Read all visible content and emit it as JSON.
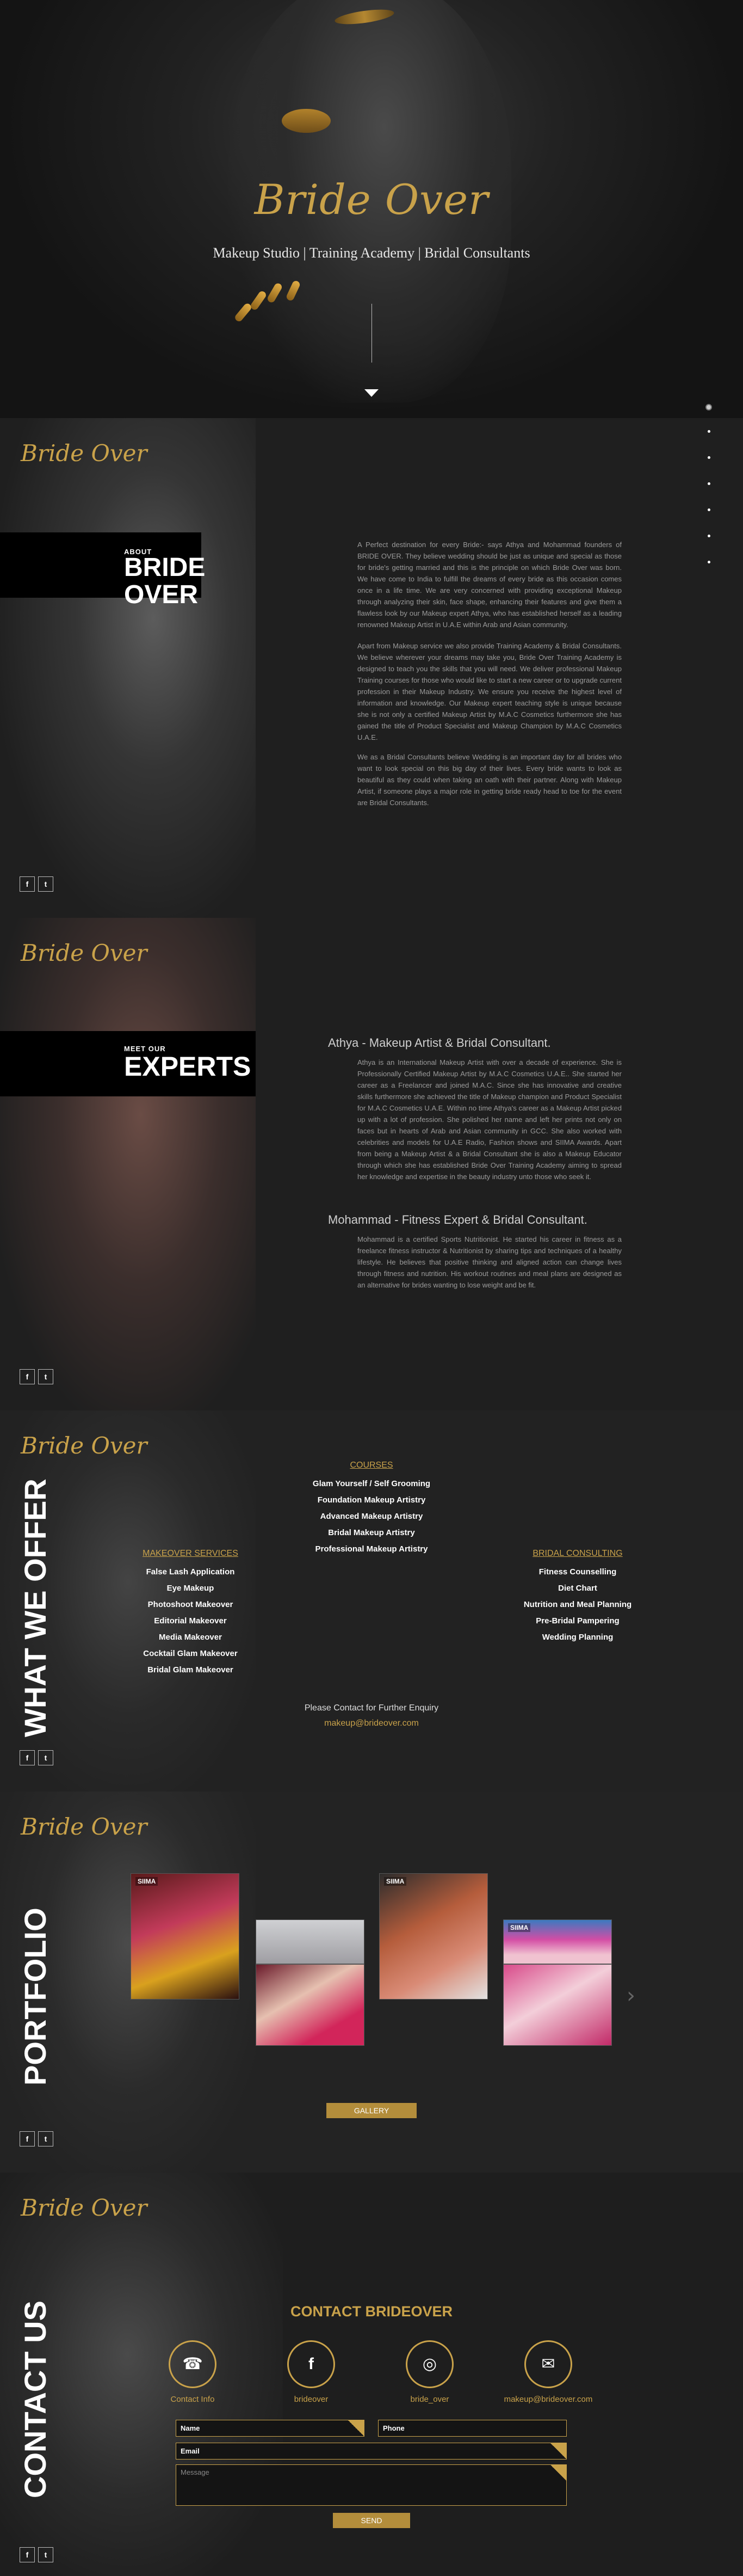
{
  "hero": {
    "logo": "Bride Over",
    "tagline": "Makeup Studio | Training Academy | Bridal Consultants"
  },
  "brand_logo": "Bride Over",
  "social": {
    "facebook": "f",
    "twitter": "t"
  },
  "about": {
    "small_title": "ABOUT",
    "big_title_1": "BRIDE",
    "big_title_2": "OVER",
    "paragraphs": [
      "A Perfect destination for every Bride:- says Athya and Mohammad founders of BRIDE OVER. They believe wedding should be just as unique and special as those for bride's getting married and this is the principle on which Bride Over was born. We have come to India to fulfill the dreams of every bride as this occasion comes once in a life time. We are very concerned with providing exceptional Makeup through analyzing their skin, face shape, enhancing their features and give them a flawless look by our Makeup expert Athya, who has established herself as a leading renowned Makeup Artist in U.A.E within Arab and Asian community.",
      "Apart from Makeup service we also provide Training Academy & Bridal Consultants. We believe wherever your dreams may take you, Bride Over Training Academy is designed to teach you the skills that you will need. We deliver professional Makeup Training courses for those who would like to start a new career or to upgrade current profession in their Makeup Industry. We ensure you receive the highest level of information and knowledge. Our Makeup expert teaching style is unique because she is not only a certified Makeup Artist by M.A.C Cosmetics furthermore she has gained the title of Product Specialist and Makeup Champion by M.A.C Cosmetics U.A.E.",
      "We as a Bridal Consultants believe Wedding is an important day for all brides who want to look special on this big day of their lives. Every bride wants to look as beautiful as they could when taking an oath with their partner. Along with Makeup Artist, if someone plays a major role in getting bride ready head to toe for the event are Bridal Consultants."
    ]
  },
  "experts": {
    "small_title": "MEET OUR",
    "big_title": "EXPERTS",
    "people": [
      {
        "heading": "Athya - Makeup Artist & Bridal Consultant.",
        "text": "Athya is an International Makeup Artist with over a decade of experience. She is Professionally Certified Makeup Artist by M.A.C Cosmetics U.A.E.. She started her career as a Freelancer and joined M.A.C. Since she has innovative and creative skills furthermore she achieved the title of Makeup champion and Product Specialist for M.A.C Cosmetics U.A.E. Within no time Athya's career as a Makeup Artist picked up with a lot of profession. She polished her name and left her prints not only on faces but in hearts of Arab and Asian community in GCC. She also worked with celebrities and models for U.A.E Radio, Fashion shows and SIIMA Awards. Apart from being a Makeup Artist & a Bridal Consultant she is also a Makeup Educator through which she has established Bride Over Training Academy aiming to spread her knowledge and expertise in the beauty industry unto those who seek it."
      },
      {
        "heading": "Mohammad - Fitness Expert & Bridal Consultant.",
        "text": "Mohammad is a certified Sports Nutritionist. He started his career in fitness as a freelance fitness instructor & Nutritionist by sharing tips and techniques of a healthy lifestyle. He believes that positive thinking and aligned action can change lives through fitness and nutrition. His workout routines and meal plans are designed as an alternative for brides wanting to lose weight and be fit."
      }
    ]
  },
  "services": {
    "vertical_title": "WHAT WE OFFER",
    "courses": {
      "head": "COURSES",
      "items": [
        "Glam Yourself / Self Grooming",
        "Foundation Makeup Artistry",
        "Advanced Makeup Artistry",
        "Bridal Makeup Artistry",
        "Professional Makeup Artistry"
      ]
    },
    "makeover": {
      "head": "MAKEOVER SERVICES",
      "items": [
        "False Lash Application",
        "Eye Makeup",
        "Photoshoot Makeover",
        "Editorial Makeover",
        "Media Makeover",
        "Cocktail Glam Makeover",
        "Bridal Glam Makeover"
      ]
    },
    "bridal": {
      "head": "BRIDAL CONSULTING",
      "items": [
        "Fitness Counselling",
        "Diet Chart",
        "Nutrition and Meal Planning",
        "Pre-Bridal Pampering",
        "Wedding Planning"
      ]
    },
    "contact_line": "Please Contact for Further Enquiry",
    "email": "makeup@brideover.com"
  },
  "portfolio": {
    "vertical_title": "PORTFOLIO",
    "photo_label": "SIIMA",
    "next": "›",
    "gallery_button": "GALLERY"
  },
  "contact": {
    "vertical_title": "CONTACT US",
    "heading": "CONTACT BRIDEOVER",
    "icons": [
      {
        "glyph": "☎",
        "label": "Contact Info"
      },
      {
        "glyph": "f",
        "label": "brideover"
      },
      {
        "glyph": "◎",
        "label": "bride_over"
      },
      {
        "glyph": "✉",
        "label": "makeup@brideover.com"
      }
    ],
    "form": {
      "name_placeholder": "Name",
      "phone_placeholder": "Phone",
      "email_placeholder": "Email",
      "message_placeholder": "Message",
      "send_button": "SEND"
    }
  },
  "colors": {
    "gold": "#c9a24a",
    "button_gold": "#b38d3b",
    "background": "#1c1c1c"
  }
}
